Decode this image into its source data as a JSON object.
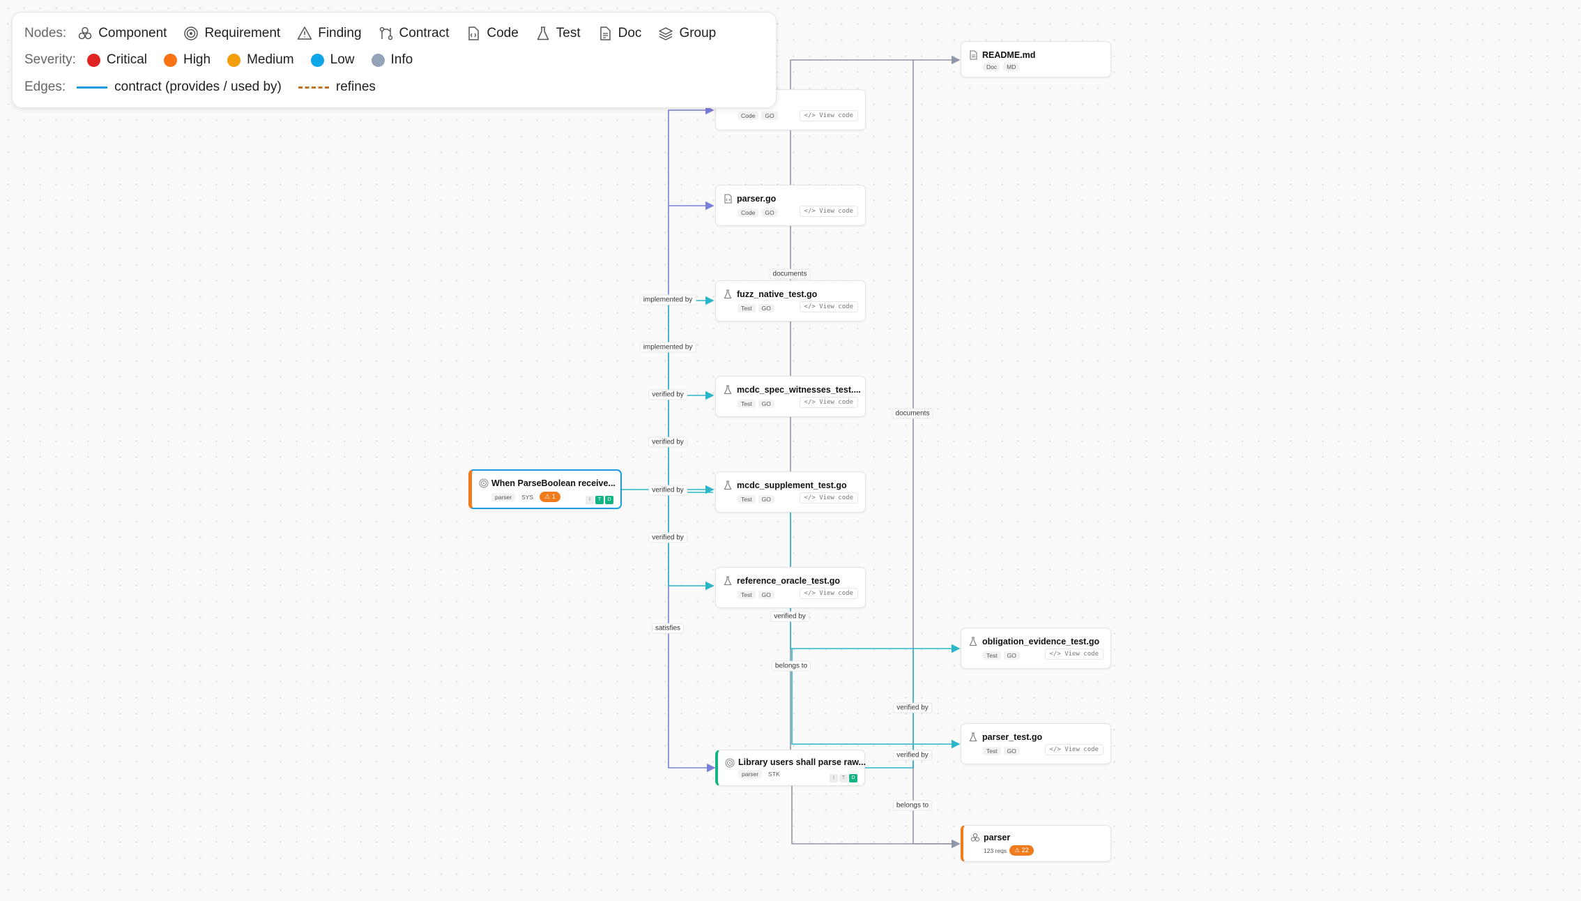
{
  "legend": {
    "nodes_label": "Nodes:",
    "node_types": [
      {
        "label": "Component",
        "icon": "component-icon"
      },
      {
        "label": "Requirement",
        "icon": "target-icon"
      },
      {
        "label": "Finding",
        "icon": "warning-triangle-icon"
      },
      {
        "label": "Contract",
        "icon": "contract-icon"
      },
      {
        "label": "Code",
        "icon": "code-file-icon"
      },
      {
        "label": "Test",
        "icon": "flask-icon"
      },
      {
        "label": "Doc",
        "icon": "document-icon"
      },
      {
        "label": "Group",
        "icon": "layers-icon"
      }
    ],
    "severity_label": "Severity:",
    "severities": [
      {
        "label": "Critical",
        "color": "#e02424"
      },
      {
        "label": "High",
        "color": "#f97316"
      },
      {
        "label": "Medium",
        "color": "#f59e0b"
      },
      {
        "label": "Low",
        "color": "#0ea5e9"
      },
      {
        "label": "Info",
        "color": "#94a3b8"
      }
    ],
    "edges_label": "Edges:",
    "edge_types": [
      {
        "label": "contract (provides / used by)",
        "color": "#1d9be0",
        "style": "solid"
      },
      {
        "label": "refines",
        "color": "#c0751c",
        "style": "dashed"
      }
    ]
  },
  "nodes": {
    "code_top": {
      "type": "Code",
      "tag1": "Code",
      "tag2": "GO",
      "action": "View code"
    },
    "parser_go": {
      "title": "parser.go",
      "tag1": "Code",
      "tag2": "GO",
      "action": "View code"
    },
    "fuzz_native": {
      "title": "fuzz_native_test.go",
      "tag1": "Test",
      "tag2": "GO",
      "action": "View code"
    },
    "mcdc_spec": {
      "title": "mcdc_spec_witnesses_test....",
      "tag1": "Test",
      "tag2": "GO",
      "action": "View code"
    },
    "mcdc_supp": {
      "title": "mcdc_supplement_test.go",
      "tag1": "Test",
      "tag2": "GO",
      "action": "View code"
    },
    "ref_oracle": {
      "title": "reference_oracle_test.go",
      "tag1": "Test",
      "tag2": "GO",
      "action": "View code"
    },
    "readme": {
      "title": "README.md",
      "tag1": "Doc",
      "tag2": "MD"
    },
    "obligation": {
      "title": "obligation_evidence_test.go",
      "tag1": "Test",
      "tag2": "GO",
      "action": "View code"
    },
    "parser_test": {
      "title": "parser_test.go",
      "tag1": "Test",
      "tag2": "GO",
      "action": "View code"
    },
    "req_sys": {
      "title": "When ParseBoolean receive...",
      "tag1": "parser",
      "tag2": "SYS",
      "findings": "1",
      "chips": [
        "I",
        "T",
        "D"
      ]
    },
    "req_stk": {
      "title": "Library users shall parse raw...",
      "tag1": "parser",
      "tag2": "STK",
      "chips": [
        "I",
        "T",
        "D"
      ]
    },
    "component": {
      "title": "parser",
      "reqs": "123 reqs",
      "findings": "22"
    }
  },
  "edge_labels": {
    "documents": "documents",
    "implemented_by": "implemented by",
    "verified_by": "verified by",
    "satisfies": "satisfies",
    "belongs_to": "belongs to"
  },
  "colors": {
    "edge_grey": "#8f97a8",
    "edge_purple": "#7b7fd9",
    "edge_teal": "#2bb5c8",
    "edge_blue": "#1d9be0",
    "selected": "#1d9be0",
    "high": "#f07b1c",
    "stk_accent": "#15b383"
  }
}
